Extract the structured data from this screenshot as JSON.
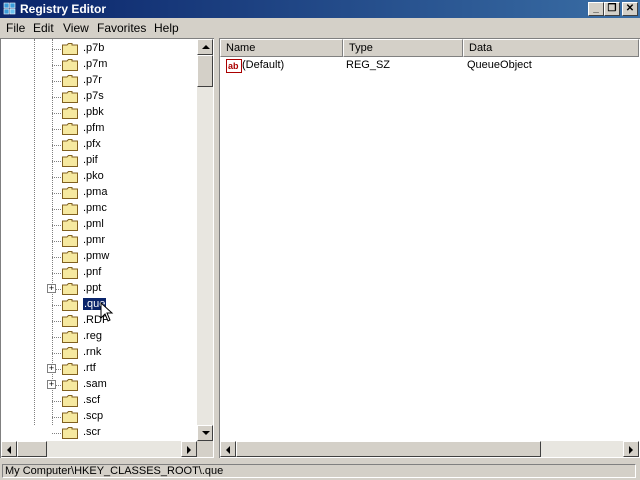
{
  "window": {
    "title": "Registry Editor"
  },
  "menu": [
    "File",
    "Edit",
    "View",
    "Favorites",
    "Help"
  ],
  "tree": {
    "items": [
      {
        "label": ".p7b",
        "expandable": false,
        "selected": false
      },
      {
        "label": ".p7m",
        "expandable": false,
        "selected": false
      },
      {
        "label": ".p7r",
        "expandable": false,
        "selected": false
      },
      {
        "label": ".p7s",
        "expandable": false,
        "selected": false
      },
      {
        "label": ".pbk",
        "expandable": false,
        "selected": false
      },
      {
        "label": ".pfm",
        "expandable": false,
        "selected": false
      },
      {
        "label": ".pfx",
        "expandable": false,
        "selected": false
      },
      {
        "label": ".pif",
        "expandable": false,
        "selected": false
      },
      {
        "label": ".pko",
        "expandable": false,
        "selected": false
      },
      {
        "label": ".pma",
        "expandable": false,
        "selected": false
      },
      {
        "label": ".pmc",
        "expandable": false,
        "selected": false
      },
      {
        "label": ".pml",
        "expandable": false,
        "selected": false
      },
      {
        "label": ".pmr",
        "expandable": false,
        "selected": false
      },
      {
        "label": ".pmw",
        "expandable": false,
        "selected": false
      },
      {
        "label": ".pnf",
        "expandable": false,
        "selected": false
      },
      {
        "label": ".ppt",
        "expandable": true,
        "selected": false
      },
      {
        "label": ".que",
        "expandable": false,
        "selected": true
      },
      {
        "label": ".RDP",
        "expandable": false,
        "selected": false
      },
      {
        "label": ".reg",
        "expandable": false,
        "selected": false
      },
      {
        "label": ".rnk",
        "expandable": false,
        "selected": false
      },
      {
        "label": ".rtf",
        "expandable": true,
        "selected": false
      },
      {
        "label": ".sam",
        "expandable": true,
        "selected": false
      },
      {
        "label": ".scf",
        "expandable": false,
        "selected": false
      },
      {
        "label": ".scp",
        "expandable": false,
        "selected": false
      },
      {
        "label": ".scr",
        "expandable": false,
        "selected": false
      }
    ]
  },
  "list": {
    "columns": [
      "Name",
      "Type",
      "Data"
    ],
    "rows": [
      {
        "name": "(Default)",
        "type": "REG_SZ",
        "data": "QueueObject",
        "icon": "string-value-icon"
      }
    ]
  },
  "status": {
    "path": "My Computer\\HKEY_CLASSES_ROOT\\.que"
  },
  "colors": {
    "titlebar": "#0a246a",
    "selection": "#0a246a",
    "face": "#d4d0c8",
    "folder": "#f6e9a0"
  }
}
